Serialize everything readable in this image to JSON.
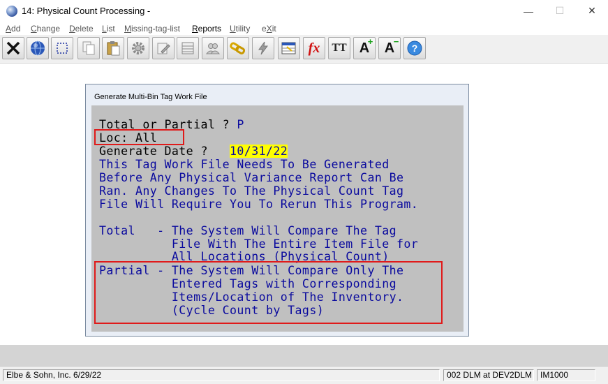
{
  "window": {
    "title": "14: Physical Count Processing -",
    "controls": {
      "minimize": "—",
      "maximize": "☐",
      "close": "✕"
    }
  },
  "menu": [
    {
      "label": "Add"
    },
    {
      "label": "Change"
    },
    {
      "label": "Delete"
    },
    {
      "label": "List"
    },
    {
      "label": "Missing-tag-list"
    },
    {
      "label": "Reports"
    },
    {
      "label": "Utility"
    },
    {
      "label": "eXit"
    }
  ],
  "toolbar": {
    "icons": [
      "exit-x-icon",
      "globe-icon",
      "select-rect-icon",
      "copy-icon",
      "paste-icon",
      "settings-gear-icon",
      "edit-pencil-icon",
      "list-grid-icon",
      "users-icon",
      "link-chain-icon",
      "lightning-icon",
      "spreadsheet-icon",
      "fx-function-icon",
      "text-case-icon",
      "font-increase-icon",
      "font-decrease-icon",
      "help-icon"
    ],
    "fx_label": "fx",
    "tt_label": "TT",
    "font_plus_label": "A",
    "font_minus_label": "A"
  },
  "dialog": {
    "title": "Generate Multi-Bin Tag Work File",
    "prompt_total_partial": "Total or Partial ? ",
    "value_total_partial": "P",
    "loc_label": "Loc: All",
    "generate_date_label": "Generate Date ?   ",
    "generate_date_value": "10/31/22",
    "info_lines": [
      "This Tag Work File Needs To Be Generated",
      "Before Any Physical Variance Report Can Be",
      "Ran. Any Changes To The Physical Count Tag",
      "File Will Require You To Rerun This Program."
    ],
    "total_lines": [
      "Total   - The System Will Compare The Tag",
      "          File With The Entire Item File for",
      "          All Locations (Physical Count)"
    ],
    "partial_lines": [
      "Partial - The System Will Compare Only The",
      "          Entered Tags with Corresponding",
      "          Items/Location of The Inventory.",
      "          (Cycle Count by Tags)"
    ]
  },
  "status": {
    "company": "Elbe & Sohn, Inc. 6/29/22",
    "session": "002 DLM at DEV2DLM",
    "program": "IM1000"
  },
  "colors": {
    "terminal_bg": "#c0c0c0",
    "terminal_text": "#0a0a9e",
    "highlight": "#ffff00",
    "annotation_red": "#e01a1a"
  }
}
